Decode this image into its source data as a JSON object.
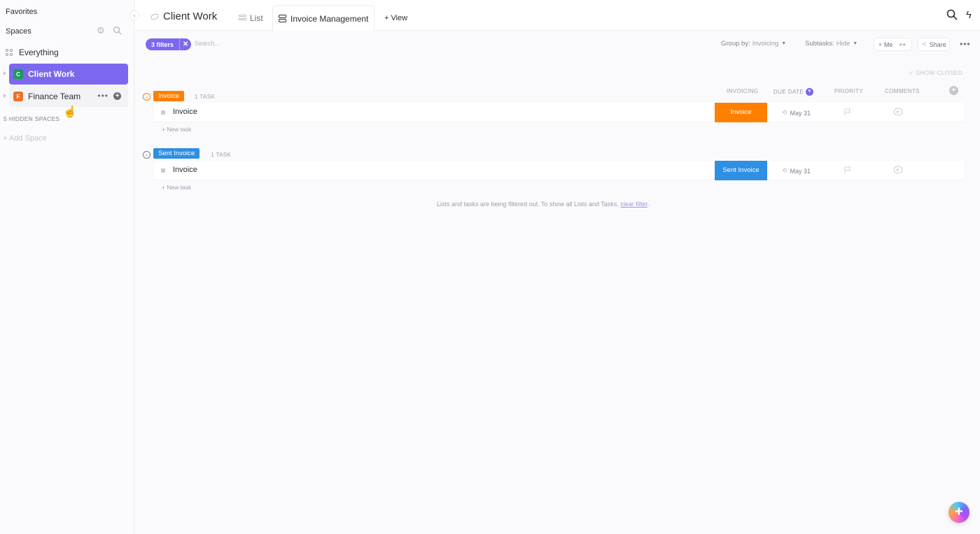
{
  "sidebar": {
    "favorites_label": "Favorites",
    "spaces_label": "Spaces",
    "everything_label": "Everything",
    "spaces": [
      {
        "label": "Client Work",
        "avatar_letter": "C",
        "avatar_color": "#1d9a5b",
        "active": true
      },
      {
        "label": "Finance Team",
        "avatar_letter": "F",
        "avatar_color": "#f07028",
        "active": false
      }
    ],
    "hidden_spaces_label": "5 HIDDEN SPACES",
    "add_space_label": "+ Add Space"
  },
  "header": {
    "title": "Client Work",
    "tabs": [
      {
        "label": "List"
      },
      {
        "label": "Invoice Management",
        "active": true
      },
      {
        "label": "+ View"
      }
    ]
  },
  "toolbar": {
    "filters_label": "3 filters",
    "search_placeholder": "Search...",
    "group_by_label": "Group by:",
    "group_by_value": "Invoicing",
    "subtasks_label": "Subtasks:",
    "subtasks_value": "Hide",
    "me_label": "Me",
    "share_label": "Share"
  },
  "show_closed_label": "SHOW CLOSED",
  "columns": {
    "invoicing": "INVOICING",
    "due_date": "DUE DATE",
    "priority": "PRIORITY",
    "comments": "COMMENTS"
  },
  "groups": [
    {
      "status": "Invoice",
      "color": "#ff7f00",
      "count_label": "1 TASK",
      "tasks": [
        {
          "name": "Invoice",
          "status": "Invoice",
          "due": "May 31"
        }
      ],
      "new_task_label": "+ New task"
    },
    {
      "status": "Sent Invoice",
      "color": "#2f8fe2",
      "count_label": "1 TASK",
      "tasks": [
        {
          "name": "Invoice",
          "status": "Sent Invoice",
          "due": "May 31"
        }
      ],
      "new_task_label": "+ New task"
    }
  ],
  "filter_message": {
    "text": "Lists and tasks are being filtered out. To show all Lists and Tasks, ",
    "link": "clear filter",
    "suffix": "."
  }
}
